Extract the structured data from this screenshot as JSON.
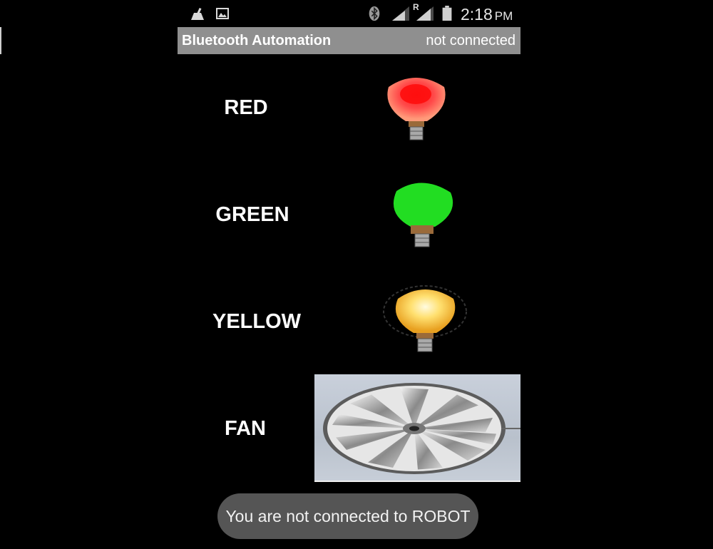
{
  "status_bar": {
    "time": "2:18",
    "ampm": "PM",
    "roaming_indicator": "R",
    "icons": [
      "clean-icon",
      "image-icon",
      "bluetooth-icon",
      "signal-icon",
      "signal-roaming-icon",
      "battery-icon"
    ]
  },
  "app_bar": {
    "title": "Bluetooth Automation",
    "connection_status": "not connected",
    "background_color": "#8f8f8f"
  },
  "controls": [
    {
      "label": "RED",
      "icon": "red-bulb-icon",
      "color": "#ff2a2a"
    },
    {
      "label": "GREEN",
      "icon": "green-bulb-icon",
      "color": "#22dd22"
    },
    {
      "label": "YELLOW",
      "icon": "yellow-bulb-icon",
      "color": "#ffd23a"
    },
    {
      "label": "FAN",
      "icon": "fan-icon",
      "color": "#c0c8d2"
    }
  ],
  "toast": {
    "message": "You are not connected to ROBOT"
  }
}
